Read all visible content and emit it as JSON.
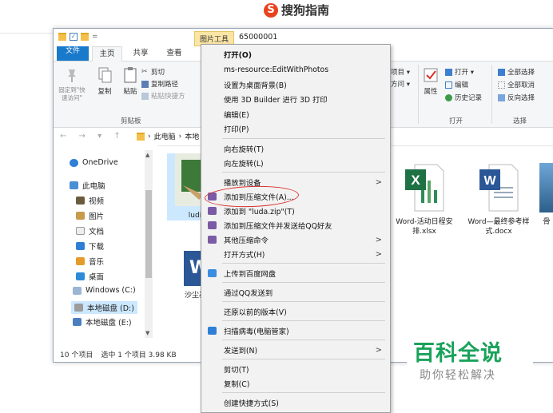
{
  "header": {
    "brand": "搜狗指南"
  },
  "window": {
    "context_tool_tab": "图片工具",
    "title": "65000001",
    "quick_access_text": "=",
    "tabs": [
      "文件",
      "主页",
      "共享",
      "查看"
    ],
    "ribbon": {
      "pin_label": "固定到\"快速访问\"",
      "copy_label": "复制",
      "paste_label": "粘贴",
      "cut_label": "剪切",
      "copy_path_label": "复制路径",
      "paste_shortcut_label": "粘贴快捷方",
      "clipboard_group": "剪贴板",
      "partial_a": "项目 ▾",
      "partial_b": "方问 ▾",
      "properties_label": "属性",
      "open_label": "打开 ▾",
      "edit_label": "编辑",
      "history_label": "历史记录",
      "open_group": "打开",
      "select_all_label": "全部选择",
      "select_none_label": "全部取消",
      "invert_label": "反向选择",
      "select_group": "选择"
    },
    "address": {
      "nav": "← → ▾ ↑",
      "path1": "此电脑",
      "path2": "本地"
    },
    "nav_items": [
      {
        "label": "OneDrive"
      },
      {
        "label": "此电脑"
      },
      {
        "label": "视频"
      },
      {
        "label": "图片"
      },
      {
        "label": "文档"
      },
      {
        "label": "下载"
      },
      {
        "label": "音乐"
      },
      {
        "label": "桌面"
      },
      {
        "label": "Windows (C:)"
      },
      {
        "label": "本地磁盘 (D:)"
      },
      {
        "label": "本地磁盘 (E:)"
      }
    ],
    "files": [
      {
        "name": "ludi"
      },
      {
        "name": "沙尘暴笔"
      },
      {
        "name": "Word-活动日程安排.xlsx"
      },
      {
        "name": "Word—最终参考样式.docx"
      },
      {
        "name": "骨"
      }
    ],
    "status": {
      "count": "10 个项目",
      "selected": "选中 1 个项目 3.98 KB"
    }
  },
  "context_menu": {
    "items": [
      {
        "label": "打开(O)"
      },
      {
        "label": "ms-resource:EditWithPhotos"
      },
      {
        "label": "设置为桌面背景(B)"
      },
      {
        "label": "使用 3D Builder 进行 3D 打印"
      },
      {
        "label": "编辑(E)"
      },
      {
        "label": "打印(P)"
      },
      {
        "label": "向右旋转(T)"
      },
      {
        "label": "向左旋转(L)"
      },
      {
        "label": "播放到设备"
      },
      {
        "label": "添加到压缩文件(A)..."
      },
      {
        "label": "添加到 \"luda.zip\"(T)"
      },
      {
        "label": "添加到压缩文件并发送给QQ好友"
      },
      {
        "label": "其他压缩命令"
      },
      {
        "label": "打开方式(H)"
      },
      {
        "label": "上传到百度网盘"
      },
      {
        "label": "通过QQ发送到"
      },
      {
        "label": "还原以前的版本(V)"
      },
      {
        "label": "扫描病毒(电脑管家)"
      },
      {
        "label": "发送到(N)"
      },
      {
        "label": "剪切(T)"
      },
      {
        "label": "复制(C)"
      },
      {
        "label": "创建快捷方式(S)"
      }
    ]
  },
  "watermark": {
    "title": "百科全说",
    "subtitle": "助你轻松解决"
  },
  "colors": {
    "accent_blue": "#1979ca",
    "highlight_red": "#d8302c",
    "watermark_green": "#1aa25b"
  }
}
